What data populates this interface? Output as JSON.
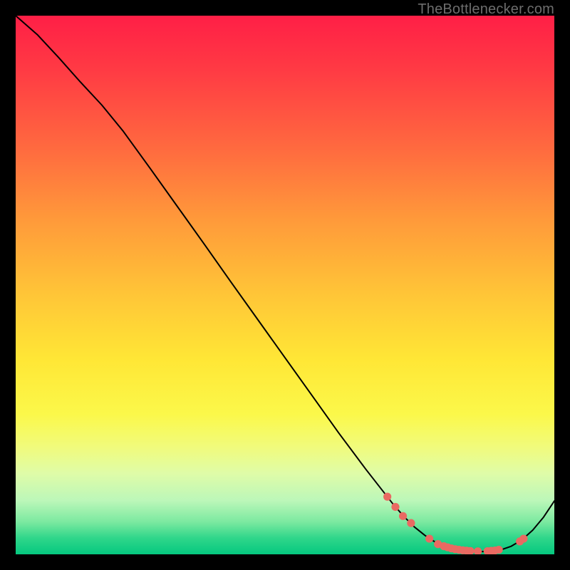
{
  "watermark": "TheBottlenecker.com",
  "chart_data": {
    "type": "line",
    "title": "",
    "xlabel": "",
    "ylabel": "",
    "xlim": [
      0,
      100
    ],
    "ylim": [
      0,
      100
    ],
    "grid": false,
    "legend": false,
    "series": [
      {
        "name": "curve",
        "x": [
          0,
          4,
          8,
          12,
          16,
          20,
          25,
          30,
          35,
          40,
          45,
          50,
          55,
          60,
          65,
          70,
          72,
          74,
          76,
          78,
          80,
          82,
          84,
          86,
          88,
          90,
          92,
          94,
          96,
          98,
          100
        ],
        "y": [
          100,
          96.5,
          92.2,
          87.7,
          83.4,
          78.5,
          71.6,
          64.6,
          57.6,
          50.5,
          43.5,
          36.5,
          29.5,
          22.5,
          15.8,
          9.4,
          7.1,
          5.1,
          3.5,
          2.2,
          1.3,
          0.8,
          0.55,
          0.5,
          0.55,
          0.8,
          1.5,
          2.7,
          4.5,
          6.9,
          9.9
        ],
        "color": "#000000",
        "linewidth": 2
      }
    ],
    "markers": [
      {
        "x": 69.0,
        "y": 10.7,
        "r": 5.6
      },
      {
        "x": 70.5,
        "y": 8.8,
        "r": 5.6
      },
      {
        "x": 71.9,
        "y": 7.1,
        "r": 5.6
      },
      {
        "x": 73.4,
        "y": 5.8,
        "r": 5.6
      },
      {
        "x": 76.8,
        "y": 2.9,
        "r": 5.6
      },
      {
        "x": 78.4,
        "y": 1.9,
        "r": 5.6
      },
      {
        "x": 79.5,
        "y": 1.5,
        "r": 5.6
      },
      {
        "x": 80.2,
        "y": 1.3,
        "r": 5.6
      },
      {
        "x": 80.9,
        "y": 1.1,
        "r": 5.6
      },
      {
        "x": 81.6,
        "y": 0.95,
        "r": 5.6
      },
      {
        "x": 82.3,
        "y": 0.85,
        "r": 5.6
      },
      {
        "x": 83.0,
        "y": 0.75,
        "r": 5.6
      },
      {
        "x": 83.7,
        "y": 0.68,
        "r": 5.6
      },
      {
        "x": 84.4,
        "y": 0.62,
        "r": 5.6
      },
      {
        "x": 85.8,
        "y": 0.55,
        "r": 5.6
      },
      {
        "x": 87.6,
        "y": 0.58,
        "r": 5.6
      },
      {
        "x": 88.3,
        "y": 0.64,
        "r": 5.6
      },
      {
        "x": 89.0,
        "y": 0.72,
        "r": 5.6
      },
      {
        "x": 89.7,
        "y": 0.85,
        "r": 5.6
      },
      {
        "x": 93.6,
        "y": 2.4,
        "r": 5.6
      },
      {
        "x": 94.3,
        "y": 2.9,
        "r": 5.6
      }
    ],
    "marker_color": "#e96a62"
  }
}
